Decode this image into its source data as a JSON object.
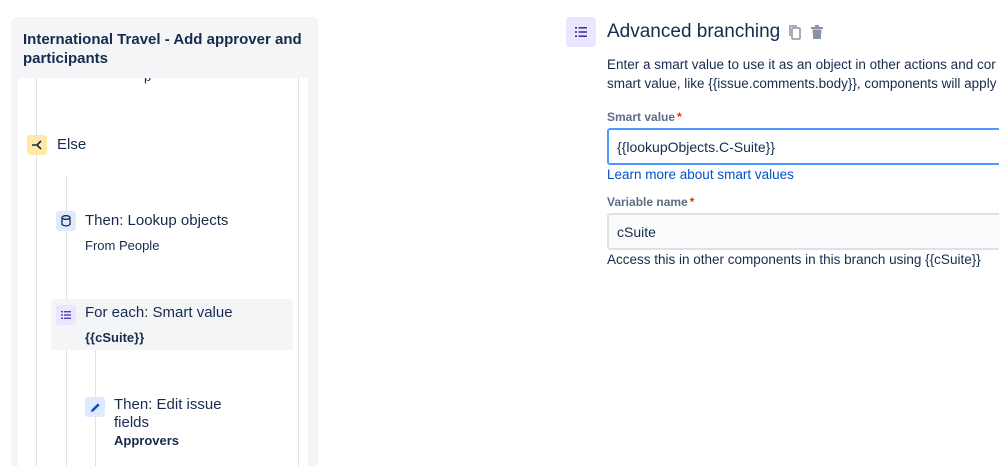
{
  "rule": {
    "title": "International Travel - Add approver and participants",
    "cut_off_text": "p",
    "else": {
      "label": "Else"
    },
    "lookup": {
      "title": "Then: Lookup objects",
      "subtitle": "From People"
    },
    "foreach": {
      "title": "For each: Smart value",
      "subtitle": "{{cSuite}}"
    },
    "edit": {
      "title_line1": "Then: Edit issue",
      "title_line2": "fields",
      "subtitle": "Approvers"
    }
  },
  "config": {
    "title": "Advanced branching",
    "description_line1": "Enter a smart value to use it as an object in other actions and cor",
    "description_line2": "smart value, like {{issue.comments.body}}, components will apply",
    "smart_value": {
      "label": "Smart value",
      "required_mark": "*",
      "value": "{{lookupObjects.C-Suite}}",
      "help_link": "Learn more about smart values"
    },
    "variable_name": {
      "label": "Variable name",
      "required_mark": "*",
      "value": "cSuite",
      "help_text": "Access this in other components in this branch using {{cSuite}}"
    }
  },
  "colors": {
    "link": "#0052cc",
    "focus_border": "#4c9aff",
    "required": "#de350b",
    "branch_icon_bg": "#eae6ff",
    "else_icon_bg": "#ffe9a8",
    "action_icon_bg": "#deebff"
  },
  "icons": [
    "list-icon",
    "branch-icon",
    "database-icon",
    "pencil-icon",
    "copy-icon",
    "trash-icon"
  ]
}
